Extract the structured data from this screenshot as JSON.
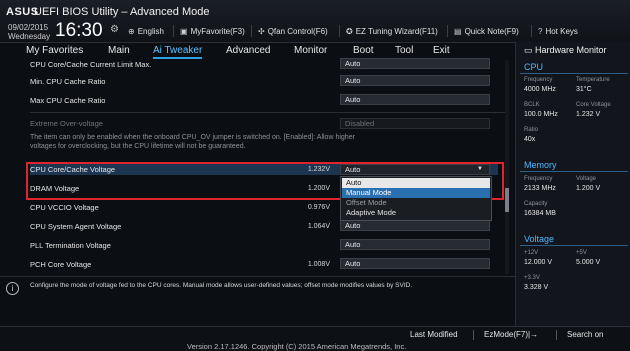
{
  "header": {
    "logo": "ASUS",
    "title": "UEFI BIOS Utility – Advanced Mode",
    "date": "09/02/2015",
    "day": "Wednesday",
    "time": "16:30",
    "tools": [
      {
        "label": "English",
        "icon": "globe-icon"
      },
      {
        "label": "MyFavorite(F3)",
        "icon": "favorite-icon"
      },
      {
        "label": "Qfan Control(F6)",
        "icon": "fan-icon"
      },
      {
        "label": "EZ Tuning Wizard(F11)",
        "icon": "wizard-icon"
      },
      {
        "label": "Quick Note(F9)",
        "icon": "note-icon"
      },
      {
        "label": "Hot Keys",
        "icon": "help-icon"
      }
    ]
  },
  "menu": [
    {
      "label": "My Favorites"
    },
    {
      "label": "Main"
    },
    {
      "label": "Ai Tweaker"
    },
    {
      "label": "Advanced"
    },
    {
      "label": "Monitor"
    },
    {
      "label": "Boot"
    },
    {
      "label": "Tool"
    },
    {
      "label": "Exit"
    }
  ],
  "settings": [
    {
      "label": "CPU Core/Cache Current Limit Max.",
      "value": "Auto"
    },
    {
      "label": "Min. CPU Cache Ratio",
      "value": "Auto"
    },
    {
      "label": "Max CPU Cache Ratio",
      "value": "Auto"
    },
    {
      "label": "Extreme Over-voltage",
      "value": "Disabled"
    },
    {
      "label": "CPU Core/Cache Voltage",
      "voltage": "1.232V",
      "value": "Auto"
    },
    {
      "label": "DRAM Voltage",
      "voltage": "1.200V"
    },
    {
      "label": "CPU VCCIO Voltage",
      "voltage": "0.976V"
    },
    {
      "label": "CPU System Agent Voltage",
      "voltage": "1.064V",
      "value": "Auto"
    },
    {
      "label": "PLL Termination Voltage",
      "value": "Auto"
    },
    {
      "label": "PCH Core Voltage",
      "voltage": "1.008V",
      "value": "Auto"
    }
  ],
  "note": "The item can only be enabled when the onboard CPU_OV jumper is switched on. [Enabled]: Allow higher voltages for overclocking, but the CPU lifetime will not be guaranteed.",
  "dropdown": {
    "options": [
      "Auto",
      "Manual Mode",
      "Offset Mode",
      "Adaptive Mode"
    ],
    "selected": "Auto",
    "hover": "Manual Mode"
  },
  "help": "Configure the mode of voltage fed to the CPU cores. Manual mode allows user-defined values; offset mode modifies values by SVID.",
  "hw": {
    "title": "Hardware Monitor",
    "cpu": {
      "title": "CPU",
      "frequency_label": "Frequency",
      "frequency": "4000 MHz",
      "temperature_label": "Temperature",
      "temperature": "31°C",
      "bclk_label": "BCLK",
      "bclk": "100.0 MHz",
      "core_voltage_label": "Core Voltage",
      "core_voltage": "1.232 V",
      "ratio_label": "Ratio",
      "ratio": "40x"
    },
    "memory": {
      "title": "Memory",
      "frequency_label": "Frequency",
      "frequency": "2133 MHz",
      "voltage_label": "Voltage",
      "voltage": "1.200 V",
      "capacity_label": "Capacity",
      "capacity": "16384 MB"
    },
    "voltage": {
      "title": "Voltage",
      "v12_label": "+12V",
      "v12": "12.000 V",
      "v5_label": "+5V",
      "v5": "5.000 V",
      "v33_label": "+3.3V",
      "v33": "3.328 V"
    }
  },
  "footer": {
    "last_modified": "Last Modified",
    "ezmode": "EzMode(F7)|→",
    "search": "Search on",
    "version": "Version 2.17.1246. Copyright (C) 2015 American Megatrends, Inc."
  },
  "colors": {
    "accent": "#4fb6ff",
    "highlight_box": "#e0242b"
  }
}
